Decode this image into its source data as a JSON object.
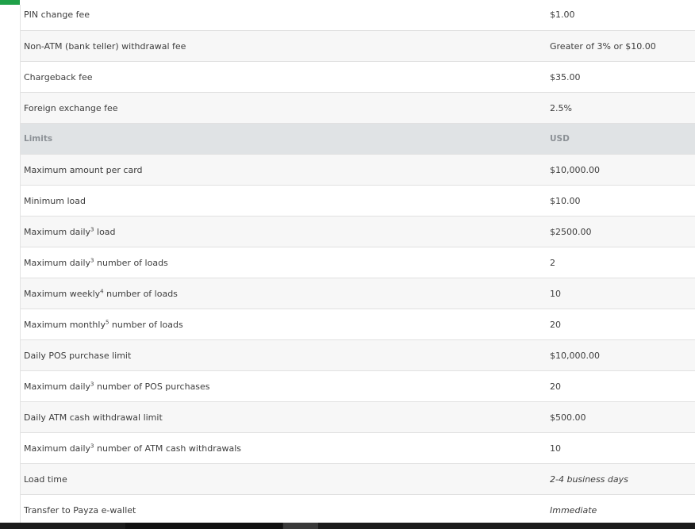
{
  "colors": {
    "accent": "#1fa149",
    "header_bg": "#e0e3e5"
  },
  "rows": [
    {
      "label": "PIN change fee",
      "value": "$1.00"
    },
    {
      "label": "Non-ATM (bank teller) withdrawal fee",
      "value": "Greater of 3% or $10.00"
    },
    {
      "label": "Chargeback fee",
      "value": "$35.00"
    },
    {
      "label": "Foreign exchange fee",
      "value": "2.5%"
    },
    {
      "label": "Limits",
      "value": "USD"
    },
    {
      "label": "Maximum amount per card",
      "value": "$10,000.00"
    },
    {
      "label": "Minimum load",
      "value": "$10.00"
    },
    {
      "label_pre": "Maximum daily",
      "sup": "3",
      "label_post": " load",
      "value": "$2500.00"
    },
    {
      "label_pre": "Maximum daily",
      "sup": "3",
      "label_post": " number of loads",
      "value": "2"
    },
    {
      "label_pre": "Maximum weekly",
      "sup": "4",
      "label_post": " number of loads",
      "value": "10"
    },
    {
      "label_pre": "Maximum monthly",
      "sup": "5",
      "label_post": " number of loads",
      "value": "20"
    },
    {
      "label": "Daily POS purchase limit",
      "value": "$10,000.00"
    },
    {
      "label_pre": "Maximum daily",
      "sup": "3",
      "label_post": " number of POS purchases",
      "value": "20"
    },
    {
      "label": "Daily ATM cash withdrawal limit",
      "value": "$500.00"
    },
    {
      "label_pre": "Maximum daily",
      "sup": "3",
      "label_post": " number of ATM cash withdrawals",
      "value": "10"
    },
    {
      "label": "Load time",
      "value": "2-4 business days"
    },
    {
      "label": "Transfer to Payza e-wallet",
      "value": "Immediate"
    }
  ]
}
